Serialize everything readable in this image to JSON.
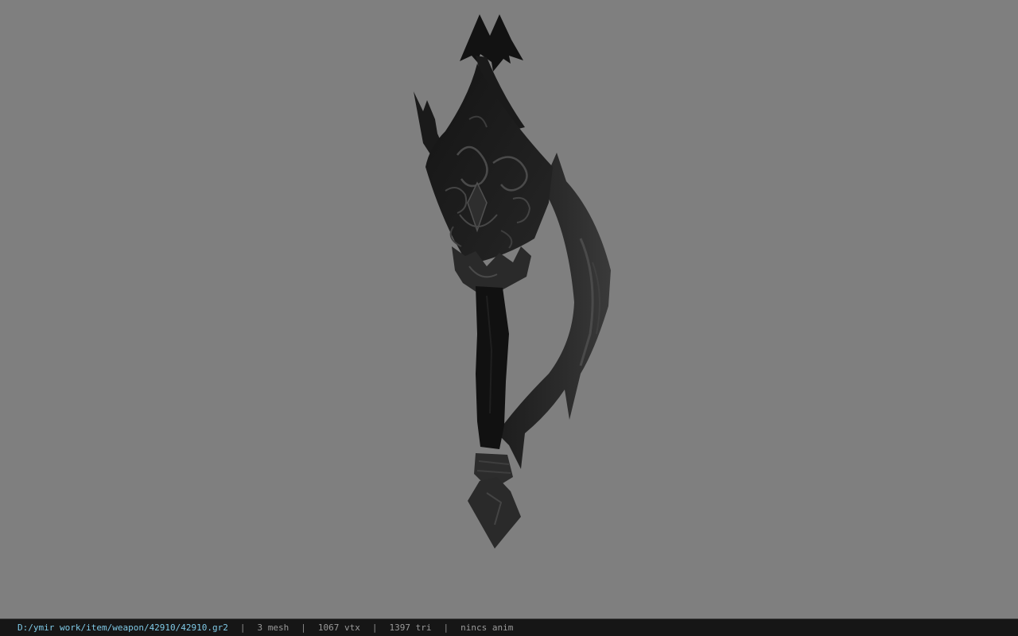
{
  "viewer": {
    "background_color": "#7f7f7f",
    "model_icon": "dark-ornate-battle-axe"
  },
  "status_bar": {
    "file_path": "D:/ymir work/item/weapon/42910/42910.gr2",
    "separator": "|",
    "mesh_count": "3 mesh",
    "vertex_count": "1067 vtx",
    "triangle_count": "1397 tri",
    "anim_status": "nincs anim",
    "path_color": "#7fc9e6",
    "text_color": "#9a9a9a",
    "background_color": "#161616"
  }
}
